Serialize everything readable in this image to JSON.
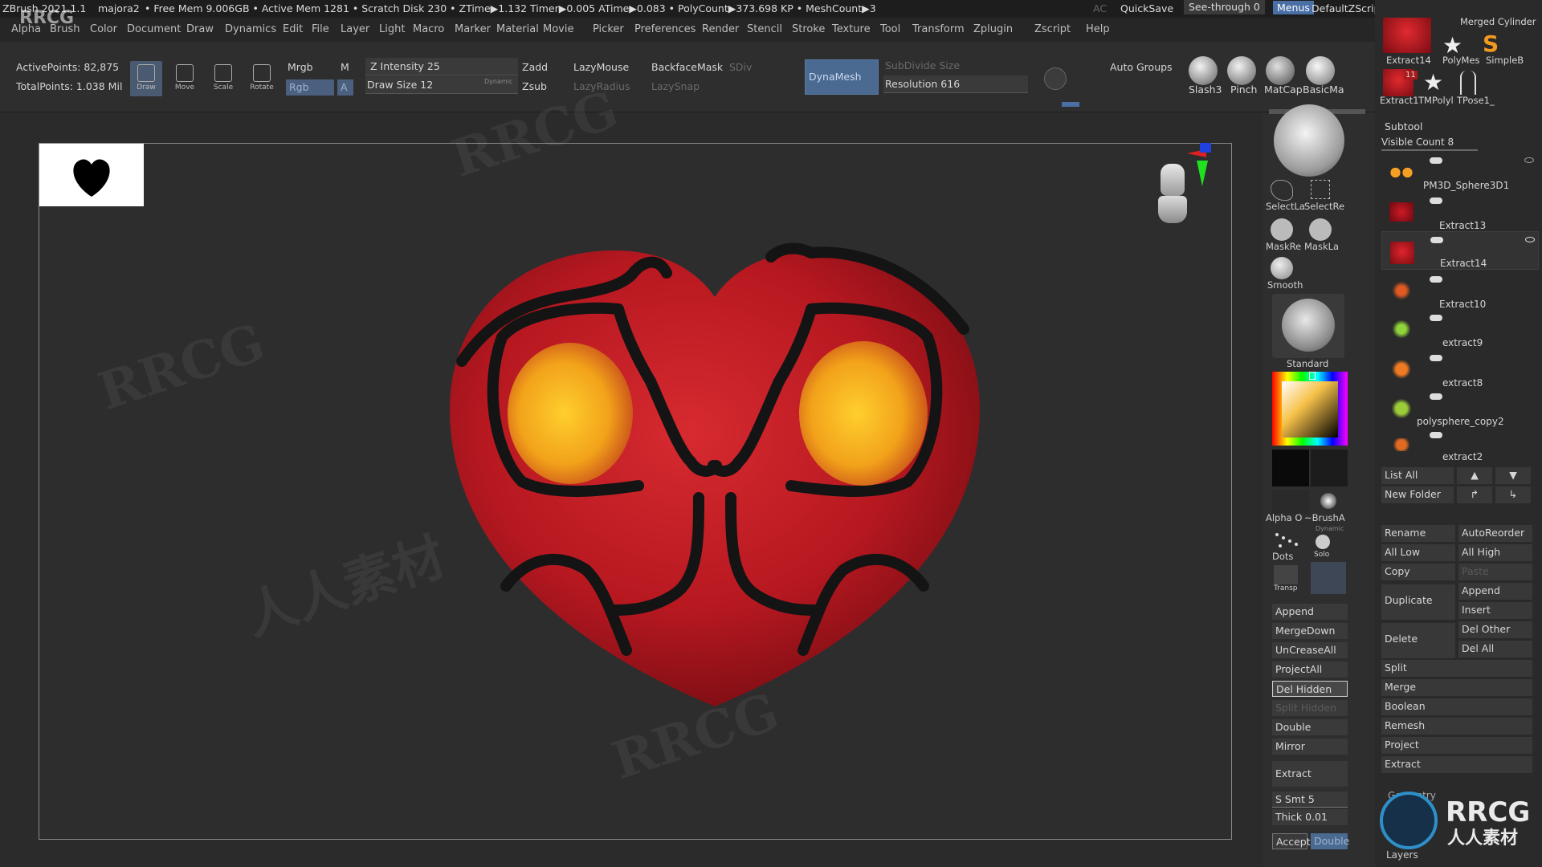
{
  "titlebar": {
    "app": "ZBrush 2021.1.1",
    "project": "majora2",
    "stats": "• Free Mem 9.006GB • Active Mem 1281 • Scratch Disk 230 • ZTime▶1.132 Timer▶0.005 ATime▶0.083 • PolyCount▶373.698 KP • MeshCount▶3",
    "ac": "AC",
    "quicksave": "QuickSave",
    "seethrough": "See-through  0",
    "menus": "Menus",
    "defaultzscript": "DefaultZScript"
  },
  "menu": [
    "Alpha",
    "Brush",
    "Color",
    "Document",
    "Draw",
    "Dynamics",
    "Edit",
    "File",
    "Layer",
    "Light",
    "Macro",
    "Marker",
    "Material",
    "Movie",
    "Picker",
    "Preferences",
    "Render",
    "Stencil",
    "Stroke",
    "Texture",
    "Tool",
    "Transform",
    "Zplugin",
    "Zscript",
    "Help"
  ],
  "toolbar": {
    "active_points": "ActivePoints: 82,875",
    "total_points": "TotalPoints: 1.038 Mil",
    "tools": [
      "Draw",
      "Move",
      "Scale",
      "Rotate"
    ],
    "mrgb": "Mrgb",
    "m": "M",
    "rgb": "Rgb",
    "a": "A",
    "zintensity": "Z Intensity 25",
    "drawsize": "Draw Size 12",
    "dynamic": "Dynamic",
    "zadd": "Zadd",
    "zsub": "Zsub",
    "lazymouse": "LazyMouse",
    "lazyradius": "LazyRadius",
    "backfacemask": "BackfaceMask",
    "lazysnap": "LazySnap",
    "sdiv": "SDiv",
    "dynamesh": "DynaMesh",
    "subdividesize": "SubDivide Size",
    "resolution": "Resolution 616",
    "autogroups": "Auto Groups",
    "brushes": [
      "Slash3",
      "Pinch",
      "MatCap",
      "BasicMa"
    ]
  },
  "rrcg_logo_small": "RRCG",
  "shelf": {
    "selectla": "SelectLa",
    "selectre": "SelectRe",
    "maskre": "MaskRe",
    "maskla": "MaskLa",
    "smooth": "Smooth",
    "standard": "Standard",
    "alpha": "Alpha O",
    "brusha": "~BrushA",
    "dynamic": "Dynamic",
    "dots": "Dots",
    "solo": "Solo",
    "transp": "Transp",
    "buttons": [
      "Append",
      "MergeDown",
      "UnCreaseAll",
      "ProjectAll",
      "Del Hidden",
      "Split Hidden",
      "Double",
      "Mirror",
      "Extract"
    ],
    "ssmt": "S Smt 5",
    "thick": "Thick 0.01",
    "accept": "Accept",
    "double2": "Double"
  },
  "subtool": {
    "top_icons": [
      "Extract14",
      "PolyMes",
      "SimpleB",
      "Extract1",
      "TMPolyl",
      "TPose1_"
    ],
    "merged": "Merged Cylinder",
    "badge": "11",
    "title": "Subtool",
    "visible_count": "Visible Count 8",
    "items": [
      "PM3D_Sphere3D1",
      "Extract13",
      "Extract14",
      "Extract10",
      "extract9",
      "extract8",
      "polysphere_copy2",
      "extract2"
    ],
    "list_all": "List All",
    "new_folder": "New Folder",
    "rename": "Rename",
    "autoreorder": "AutoReorder",
    "all_low": "All Low",
    "all_high": "All High",
    "copy": "Copy",
    "paste": "Paste",
    "duplicate": "Duplicate",
    "append": "Append",
    "insert": "Insert",
    "delete": "Delete",
    "del_other": "Del Other",
    "del_all": "Del All",
    "actions": [
      "Split",
      "Merge",
      "Boolean",
      "Remesh",
      "Project",
      "Extract"
    ],
    "geometry": "Geometry",
    "layers": "Layers"
  },
  "watermark": {
    "logo": "RRCG",
    "logo_sub": "人人素材"
  },
  "colors": {
    "mask_red": "#c41a23",
    "eye_orange": "#f2a21a",
    "stroke_dark": "#141414",
    "dynamesh_blue": "#4b6a92",
    "menus_blue": "#4a6fa5"
  }
}
